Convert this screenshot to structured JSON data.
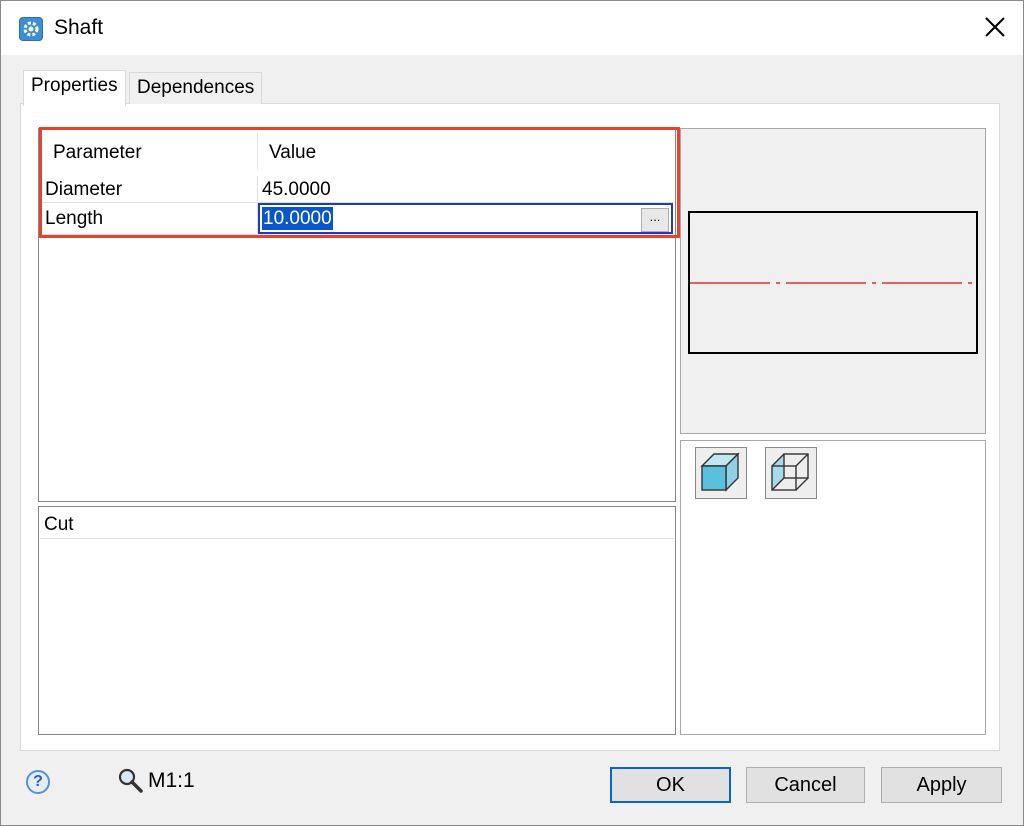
{
  "window": {
    "title": "Shaft"
  },
  "tabs": [
    {
      "label": "Properties",
      "active": true
    },
    {
      "label": "Dependences",
      "active": false
    }
  ],
  "parameters": {
    "header": {
      "parameter": "Parameter",
      "value": "Value"
    },
    "rows": [
      {
        "name": "Diameter",
        "value": "45.0000"
      },
      {
        "name": "Length",
        "value": "10.0000",
        "editing": true
      }
    ],
    "ellipsis_label": "..."
  },
  "cut": {
    "header": "Cut"
  },
  "footer": {
    "help_label": "?",
    "scale": "M1:1",
    "ok_label": "OK",
    "cancel_label": "Cancel",
    "apply_label": "Apply"
  },
  "colors": {
    "accent": "#0a64c8",
    "highlight": "#e2452f",
    "axis": "#e03030",
    "cube": "#5bc0de"
  },
  "icons": {
    "app": "gear-icon",
    "close": "close-icon",
    "solid_view": "solid-cube-icon",
    "wireframe_view": "wireframe-cube-icon",
    "zoom": "magnifier-icon",
    "help": "help-icon"
  }
}
